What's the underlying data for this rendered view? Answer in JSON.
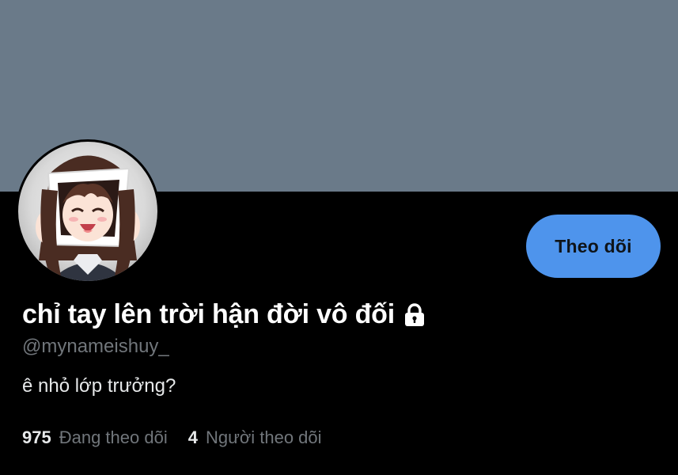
{
  "profile": {
    "display_name": "chỉ tay lên trời hận đời vô đối",
    "username": "@mynameishuy_",
    "bio": "ê nhỏ lớp trưởng?",
    "locked": true,
    "follow_button_label": "Theo dõi"
  },
  "stats": {
    "following_count": "975",
    "following_label": "Đang theo dõi",
    "followers_count": "4",
    "followers_label": "Người theo dõi"
  },
  "colors": {
    "banner": "#6a7a89",
    "background": "#000000",
    "accent": "#4e94ec",
    "secondary_text": "#71767b"
  },
  "icons": {
    "lock": "lock-icon",
    "avatar": "anime-girl-avatar"
  }
}
